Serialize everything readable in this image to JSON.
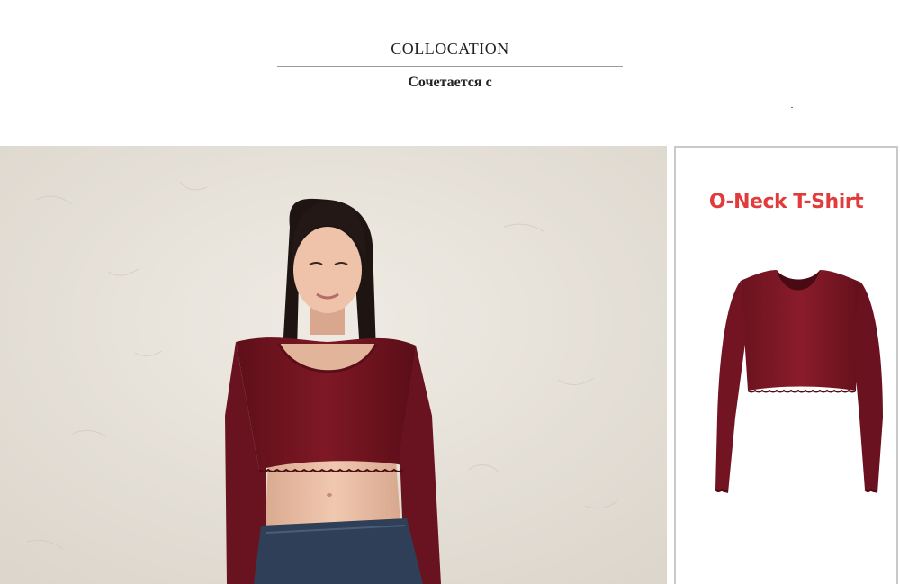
{
  "header": {
    "title": "COLLOCATION",
    "subtitle": "Сочетается с"
  },
  "product": {
    "label": "O-Neck T-Shirt",
    "label_color": "#e23b3b"
  },
  "colors": {
    "garment": "#7a1522",
    "wall": "#e9e5dd",
    "jeans": "#2e3f57"
  }
}
